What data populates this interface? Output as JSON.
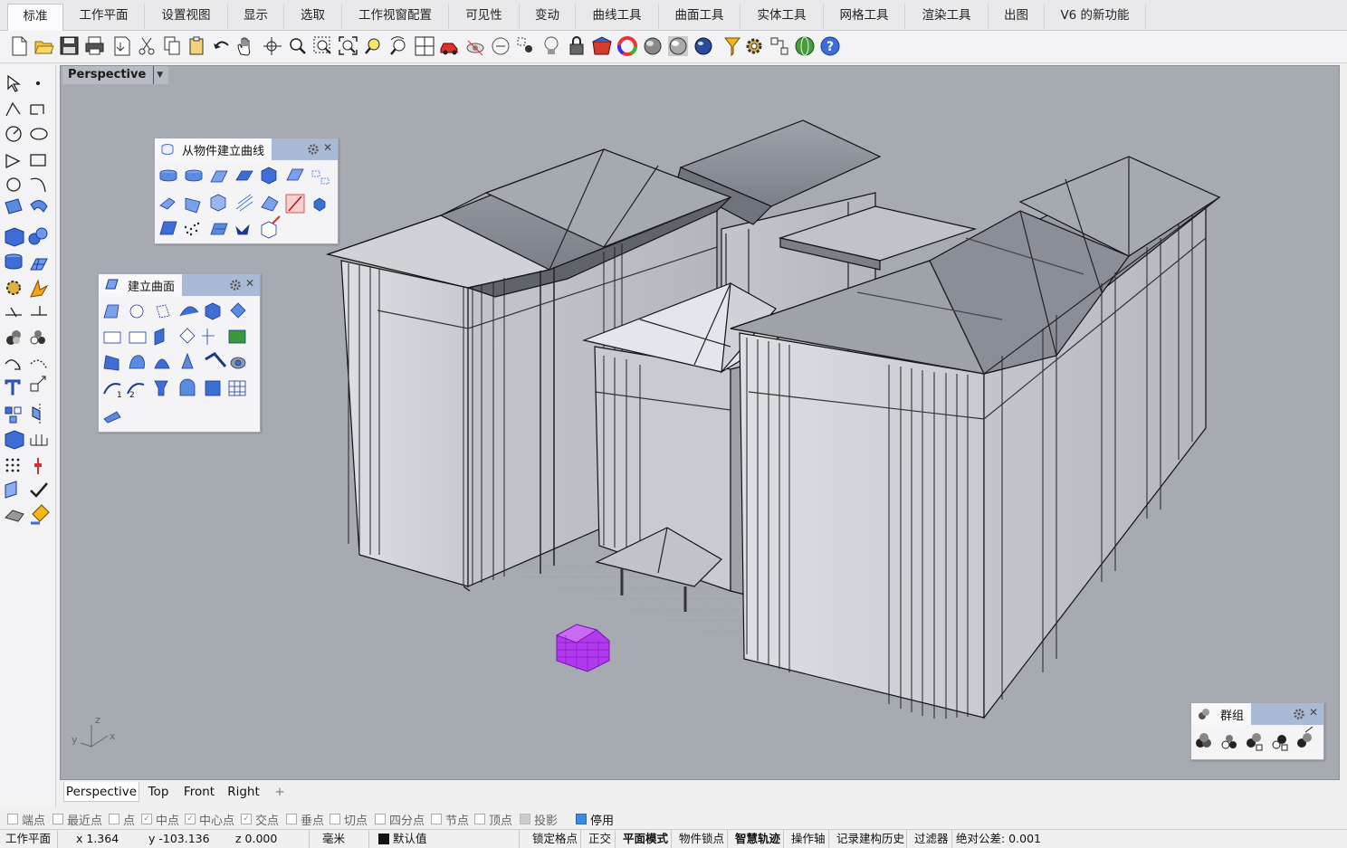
{
  "tabs": [
    {
      "label": "标准",
      "active": true
    },
    {
      "label": "工作平面"
    },
    {
      "label": "设置视图"
    },
    {
      "label": "显示"
    },
    {
      "label": "选取"
    },
    {
      "label": "工作视窗配置"
    },
    {
      "label": "可见性"
    },
    {
      "label": "变动"
    },
    {
      "label": "曲线工具"
    },
    {
      "label": "曲面工具"
    },
    {
      "label": "实体工具"
    },
    {
      "label": "网格工具"
    },
    {
      "label": "渲染工具"
    },
    {
      "label": "出图"
    },
    {
      "label": "V6 的新功能"
    }
  ],
  "toolbar_icons": [
    "new-file-icon",
    "open-folder-icon",
    "save-icon",
    "print-icon",
    "import-icon",
    "cut-icon",
    "copy-icon",
    "paste-icon",
    "undo-icon",
    "pan-hand-icon",
    "rotate-view-icon",
    "zoom-icon",
    "zoom-window-icon",
    "zoom-extents-icon",
    "zoom-selected-icon",
    "zoom-dynamic-icon",
    "four-viewports-icon",
    "car-icon",
    "hide-icon",
    "lock-view-icon",
    "point-icon",
    "light-bulb-icon",
    "lock-icon",
    "material-icon",
    "color-wheel-icon",
    "sphere-shade-icon",
    "sphere-ghost-icon",
    "sphere-render-icon",
    "options-icon",
    "gear-settings-icon",
    "grasshopper-icon",
    "globe-icon",
    "help-icon"
  ],
  "viewport": {
    "title": "Perspective",
    "axis": {
      "x": "x",
      "y": "y",
      "z": "z"
    }
  },
  "panels": {
    "curves_from_objects": {
      "title": "从物件建立曲线"
    },
    "create_surface": {
      "title": "建立曲面"
    },
    "group": {
      "title": "群组"
    }
  },
  "viewport_tabs": [
    {
      "label": "Perspective",
      "active": true
    },
    {
      "label": "Top"
    },
    {
      "label": "Front"
    },
    {
      "label": "Right"
    },
    {
      "label": "+"
    }
  ],
  "osnaps": [
    {
      "label": "端点",
      "checked": false
    },
    {
      "label": "最近点",
      "checked": false
    },
    {
      "label": "点",
      "checked": false
    },
    {
      "label": "中点",
      "checked": true
    },
    {
      "label": "中心点",
      "checked": true
    },
    {
      "label": "交点",
      "checked": true
    },
    {
      "label": "垂点",
      "checked": false
    },
    {
      "label": "切点",
      "checked": false
    },
    {
      "label": "四分点",
      "checked": false
    },
    {
      "label": "节点",
      "checked": false
    },
    {
      "label": "顶点",
      "checked": false
    },
    {
      "label": "投影",
      "checked": false
    },
    {
      "label": "停用",
      "checked": true
    }
  ],
  "status": {
    "cplane": "工作平面",
    "x": "x 1.364",
    "y": "y -103.136",
    "z": "z 0.000",
    "units": "毫米",
    "layer": "默认值",
    "grid_snap": "锁定格点",
    "ortho": "正交",
    "planar": "平面模式",
    "osnap": "物件锁点",
    "smarttrack": "智慧轨迹",
    "gumball": "操作轴",
    "history": "记录建构历史",
    "filter": "过滤器",
    "tolerance": "绝对公差: 0.001"
  }
}
